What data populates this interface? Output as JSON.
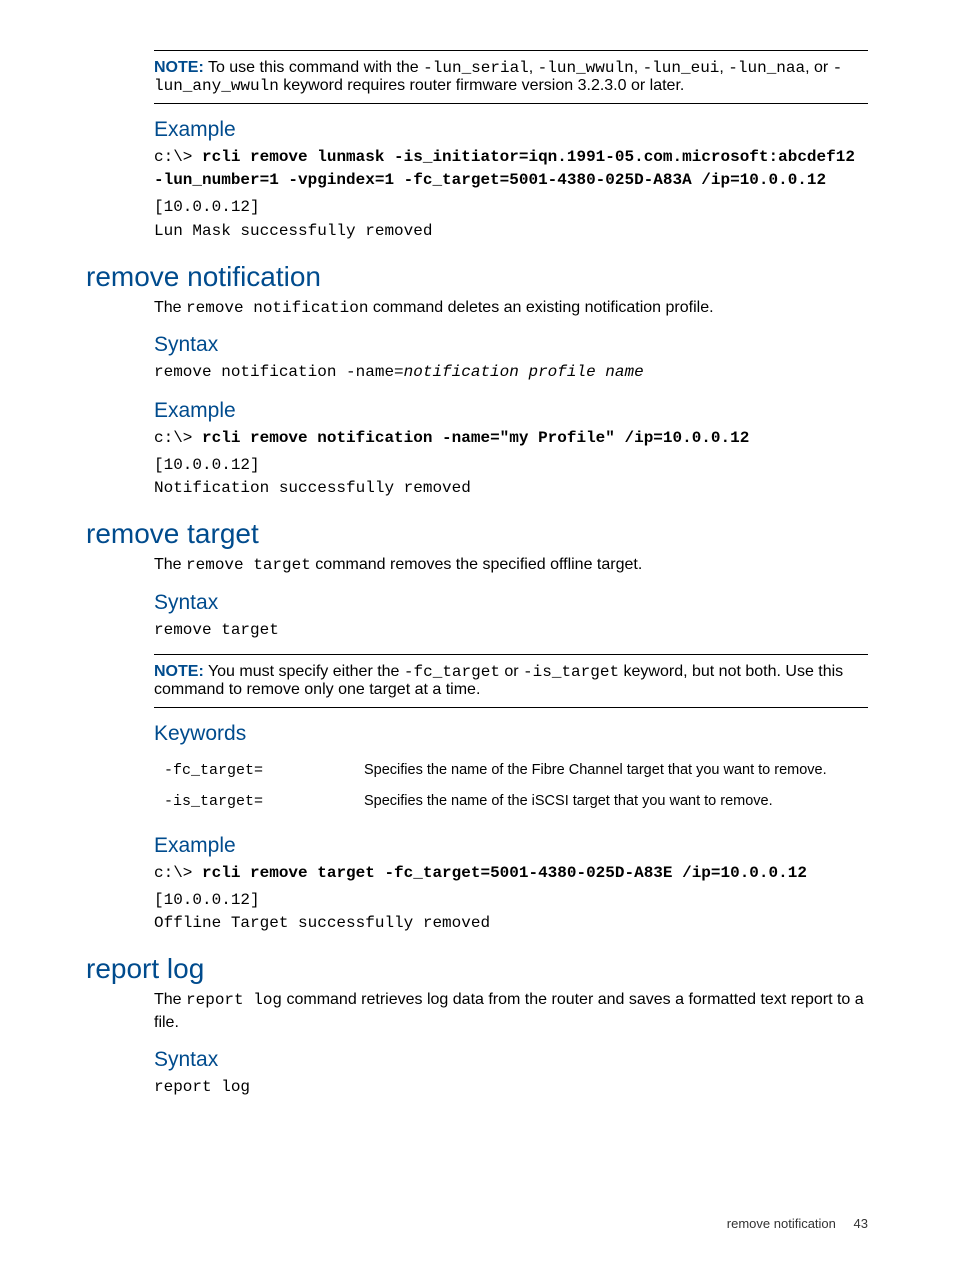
{
  "note1": {
    "label": "NOTE:",
    "pre": "To use this command with the ",
    "k1": "-lun_serial",
    "c1": ", ",
    "k2": "-lun_wwuln",
    "c2": ", ",
    "k3": "-lun_eui",
    "c3": ", ",
    "k4": "-lun_naa",
    "c4": ", or ",
    "k5": "-lun_any_wwuln",
    "post": " keyword requires router firmware version 3.2.3.0 or later."
  },
  "s1": {
    "example_h": "Example",
    "example_pre": "c:\\> rcli remove lunmask -is_initiator=iqn.1991-05.com.microsoft:abcdef12\n-lun_number=1 -vpgindex=1 -fc_target=5001-4380-025D-A83A /ip=10.0.0.12",
    "example_out": "[10.0.0.12]\nLun Mask successfully removed"
  },
  "s2": {
    "title": "remove notification",
    "intro_pre": "The ",
    "intro_code": "remove notification",
    "intro_post": " command deletes an existing notification profile.",
    "syntax_h": "Syntax",
    "syntax_pre": "remove notification -name=",
    "syntax_it": "notification profile name",
    "example_h": "Example",
    "example_prompt": "c:\\> ",
    "example_cmd": "rcli remove notification -name=\"my Profile\" /ip=10.0.0.12",
    "example_out": "[10.0.0.12]\nNotification successfully removed"
  },
  "s3": {
    "title": "remove target",
    "intro_pre": "The ",
    "intro_code": "remove target",
    "intro_post": " command removes the specified offline target.",
    "syntax_h": "Syntax",
    "syntax_code": "remove target",
    "note_label": "NOTE:",
    "note_pre": "You must specify either the ",
    "note_k1": "-fc_target",
    "note_mid": " or ",
    "note_k2": "-is_target",
    "note_post": " keyword, but not both. Use this command to remove only one target at a time.",
    "keywords_h": "Keywords",
    "kw": [
      {
        "name": "-fc_target=",
        "desc": "Specifies the name of the Fibre Channel target that you want to remove."
      },
      {
        "name": "-is_target=",
        "desc": "Specifies the name of the iSCSI target that you want to remove."
      }
    ],
    "example_h": "Example",
    "example_prompt": "c:\\> ",
    "example_cmd": "rcli remove target -fc_target=5001-4380-025D-A83E /ip=10.0.0.12",
    "example_out": "[10.0.0.12]\nOffline Target successfully removed"
  },
  "s4": {
    "title": "report log",
    "intro_pre": "The ",
    "intro_code": "report log",
    "intro_post": " command retrieves log data from the router and saves a formatted text report to a file.",
    "syntax_h": "Syntax",
    "syntax_code": "report log"
  },
  "footer": {
    "section": "remove notification",
    "page": "43"
  }
}
